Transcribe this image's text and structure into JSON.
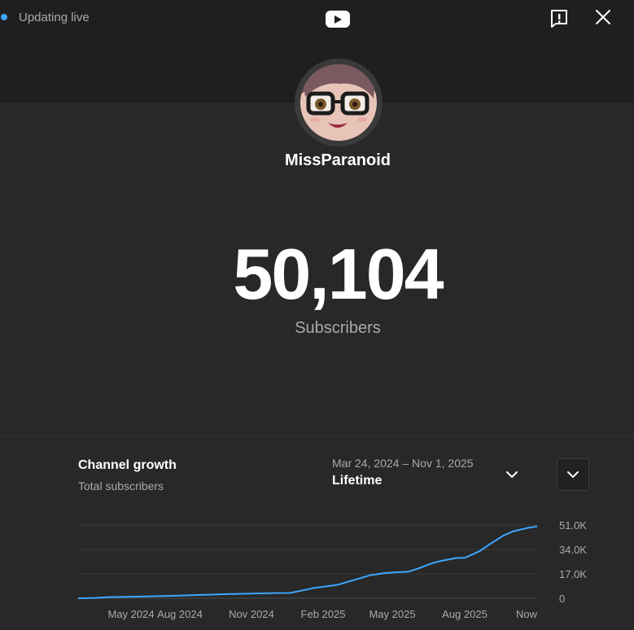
{
  "header": {
    "live_label": "Updating live",
    "logo_icon": "youtube-logo-icon",
    "report_icon": "report-icon",
    "close_icon": "close-icon"
  },
  "channel": {
    "name": "MissParanoid",
    "avatar_icon": "channel-avatar"
  },
  "stats": {
    "count": "50,104",
    "label": "Subscribers"
  },
  "growth": {
    "title": "Channel growth",
    "subtitle": "Total subscribers",
    "date_range": "Mar 24, 2024 – Nov 1, 2025",
    "range_label": "Lifetime",
    "range_chevron_icon": "chevron-down-icon",
    "expand_icon": "chevron-down-icon"
  },
  "colors": {
    "accent": "#3ea6ff",
    "line": "#3ea6ff",
    "background": "#282828",
    "header_band": "#1f1f1f"
  },
  "chart_data": {
    "type": "line",
    "x_ticks": [
      "May 2024",
      "Aug 2024",
      "Nov 2024",
      "Feb 2025",
      "May 2025",
      "Aug 2025",
      "Now"
    ],
    "y_ticks": [
      "0",
      "17.0K",
      "34.0K",
      "51.0K"
    ],
    "ylim": [
      0,
      51000
    ],
    "grid": true,
    "series": [
      {
        "x": [
          "2024-03-24",
          "2024-04-15",
          "2024-05-01",
          "2024-06-01",
          "2024-07-01",
          "2024-08-01",
          "2024-09-01",
          "2024-10-01",
          "2024-11-01",
          "2024-12-01",
          "2024-12-20",
          "2025-01-01",
          "2025-01-20",
          "2025-02-01",
          "2025-02-20",
          "2025-03-01",
          "2025-03-20",
          "2025-04-01",
          "2025-04-20",
          "2025-05-01",
          "2025-05-20",
          "2025-06-01",
          "2025-06-20",
          "2025-07-01",
          "2025-07-20",
          "2025-08-01",
          "2025-08-20",
          "2025-09-01",
          "2025-09-20",
          "2025-10-01",
          "2025-10-20",
          "2025-11-01"
        ],
        "values": [
          0,
          200,
          800,
          1100,
          1400,
          1800,
          2400,
          2900,
          3300,
          3600,
          3700,
          5000,
          7200,
          8000,
          9500,
          11000,
          14000,
          16000,
          17500,
          18000,
          18500,
          20500,
          24500,
          26000,
          28000,
          28200,
          33000,
          37500,
          44000,
          46500,
          49000,
          50100
        ]
      }
    ]
  }
}
